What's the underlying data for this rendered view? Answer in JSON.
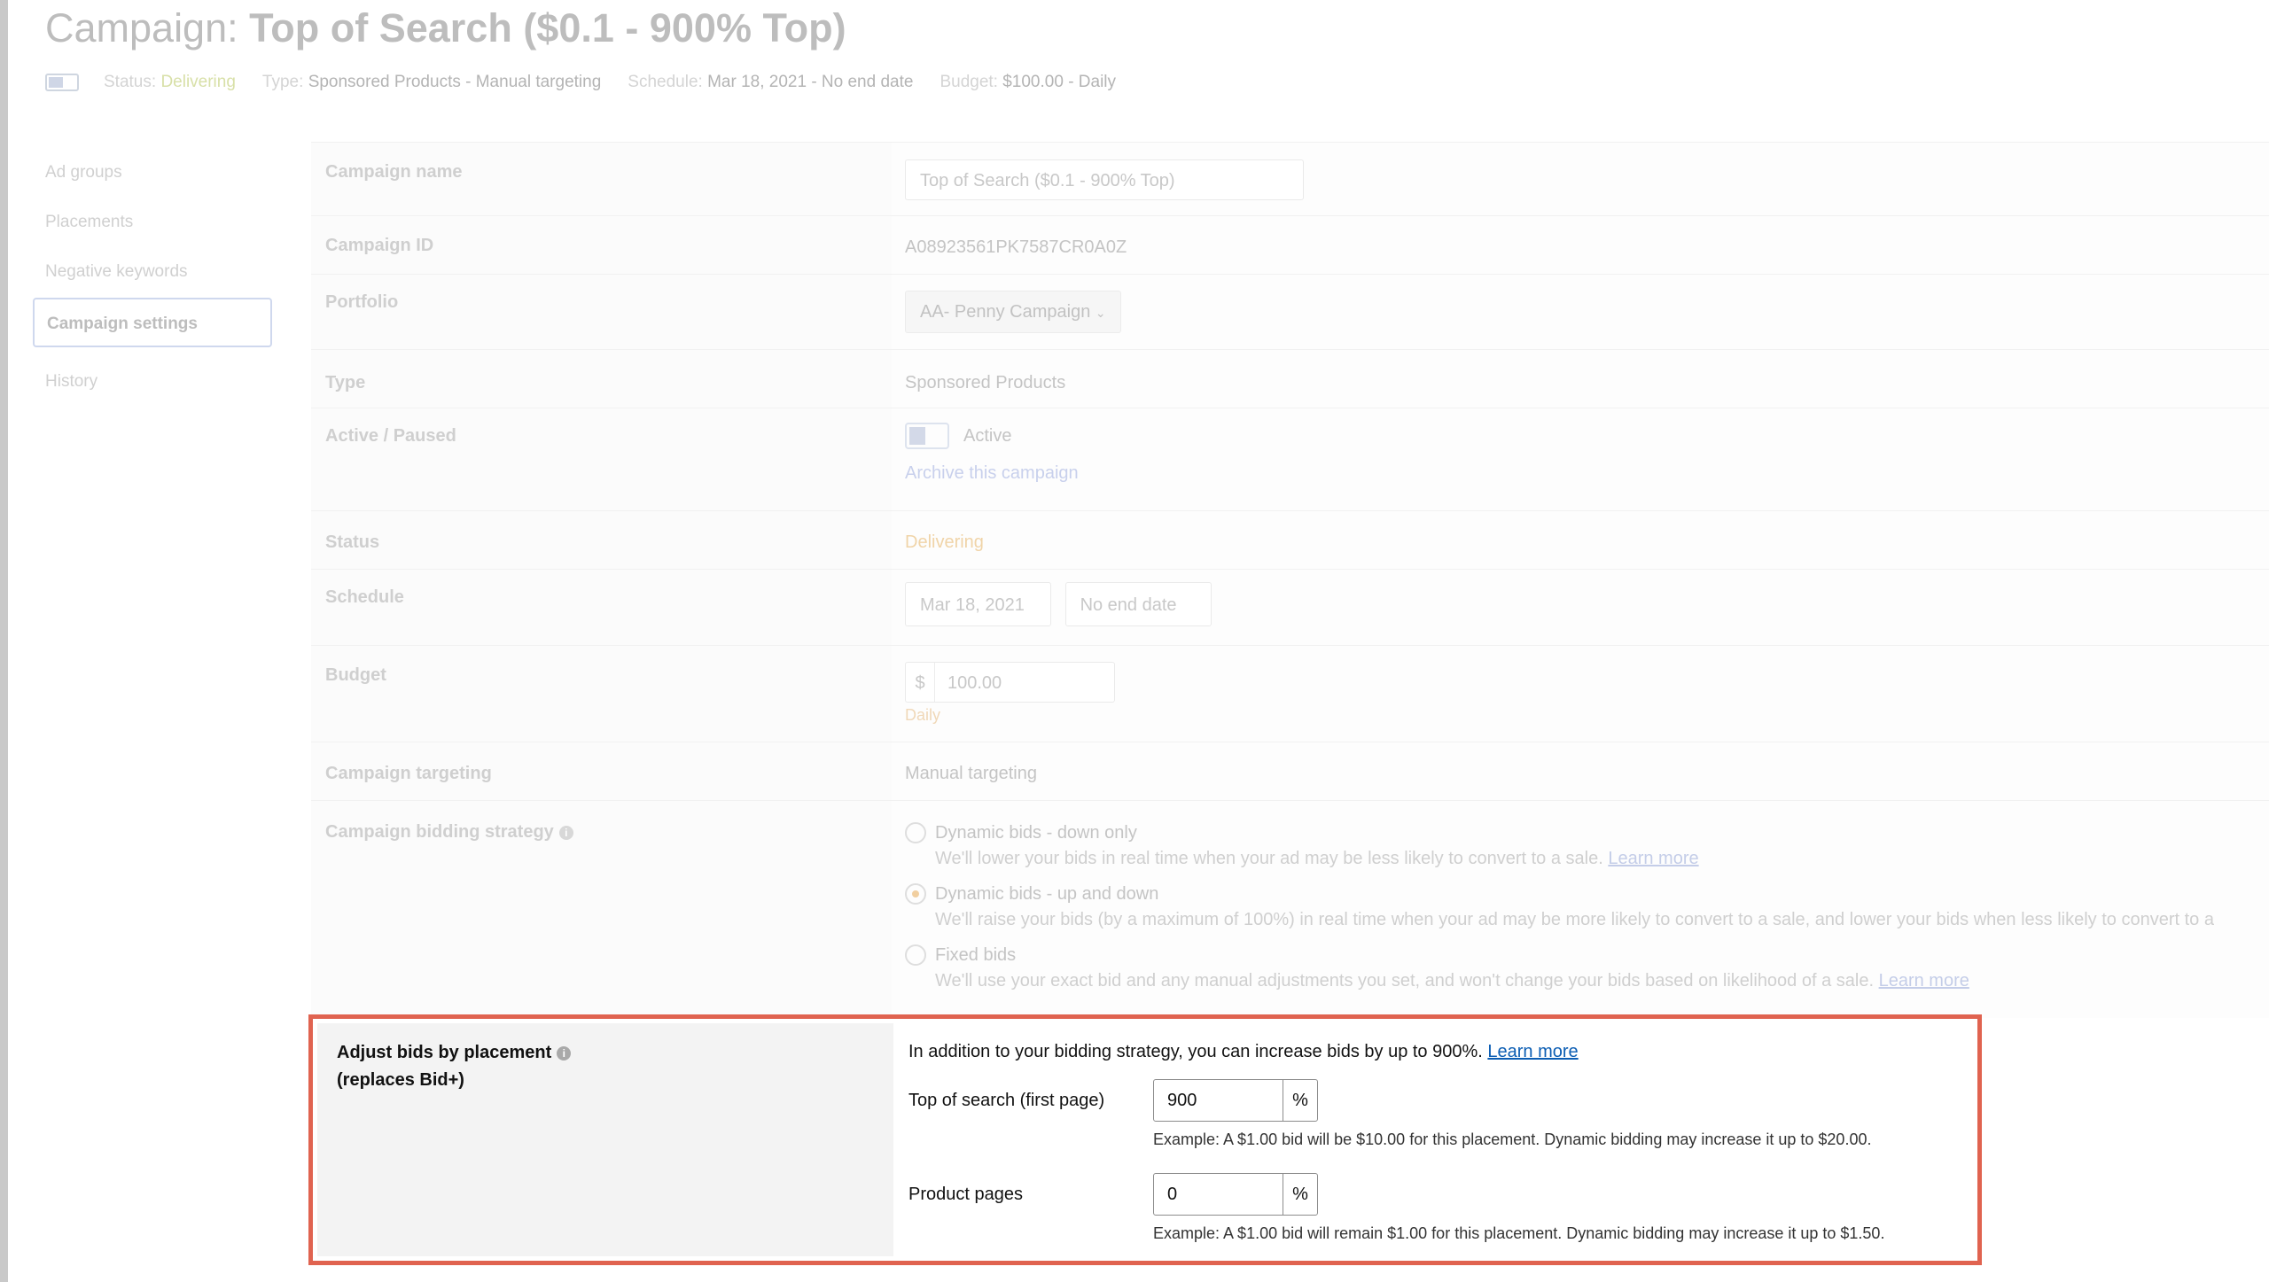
{
  "header": {
    "title_prefix": "Campaign: ",
    "title_name": "Top of Search ($0.1 - 900% Top)",
    "status_label": "Status:",
    "status_value": "Delivering",
    "type_label": "Type:",
    "type_value": "Sponsored Products - Manual targeting",
    "schedule_label": "Schedule:",
    "schedule_value": "Mar 18, 2021 - No end date",
    "budget_label": "Budget:",
    "budget_value": "$100.00 - Daily"
  },
  "sidebar": {
    "items": [
      {
        "label": "Ad groups"
      },
      {
        "label": "Placements"
      },
      {
        "label": "Negative keywords"
      },
      {
        "label": "Campaign settings"
      },
      {
        "label": "History"
      }
    ]
  },
  "settings": {
    "campaign_name": {
      "label": "Campaign name",
      "value": "Top of Search ($0.1 - 900% Top)"
    },
    "campaign_id": {
      "label": "Campaign ID",
      "value": "A08923561PK7587CR0A0Z"
    },
    "portfolio": {
      "label": "Portfolio",
      "value": "AA- Penny Campaign"
    },
    "type": {
      "label": "Type",
      "value": "Sponsored Products"
    },
    "active": {
      "label": "Active / Paused",
      "toggle_label": "Active",
      "archive_link": "Archive this campaign"
    },
    "status": {
      "label": "Status",
      "value": "Delivering"
    },
    "schedule": {
      "label": "Schedule",
      "start": "Mar 18, 2021",
      "end": "No end date"
    },
    "budget": {
      "label": "Budget",
      "currency": "$",
      "value": "100.00",
      "period": "Daily"
    },
    "targeting": {
      "label": "Campaign targeting",
      "value": "Manual targeting"
    },
    "bidding": {
      "label": "Campaign bidding strategy",
      "options": [
        {
          "label": "Dynamic bids - down only",
          "desc": "We'll lower your bids in real time when your ad may be less likely to convert to a sale.",
          "link": "Learn more"
        },
        {
          "label": "Dynamic bids - up and down",
          "desc": "We'll raise your bids (by a maximum of 100%) in real time when your ad may be more likely to convert to a sale, and lower your bids when less likely to convert to a",
          "link": ""
        },
        {
          "label": "Fixed bids",
          "desc": "We'll use your exact bid and any manual adjustments you set, and won't change your bids based on likelihood of a sale.",
          "link": "Learn more"
        }
      ]
    }
  },
  "placement": {
    "label_line1": "Adjust bids by placement",
    "label_line2": "(replaces Bid+)",
    "intro": "In addition to your bidding strategy, you can increase bids by up to 900%.",
    "intro_link": "Learn more",
    "top_label": "Top of search (first page)",
    "top_value": "900",
    "top_unit": "%",
    "top_example": "Example: A $1.00 bid will be $10.00 for this placement. Dynamic bidding may increase it up to $20.00.",
    "product_label": "Product pages",
    "product_value": "0",
    "product_unit": "%",
    "product_example": "Example: A $1.00 bid will remain $1.00 for this placement. Dynamic bidding may increase it up to $1.50."
  }
}
